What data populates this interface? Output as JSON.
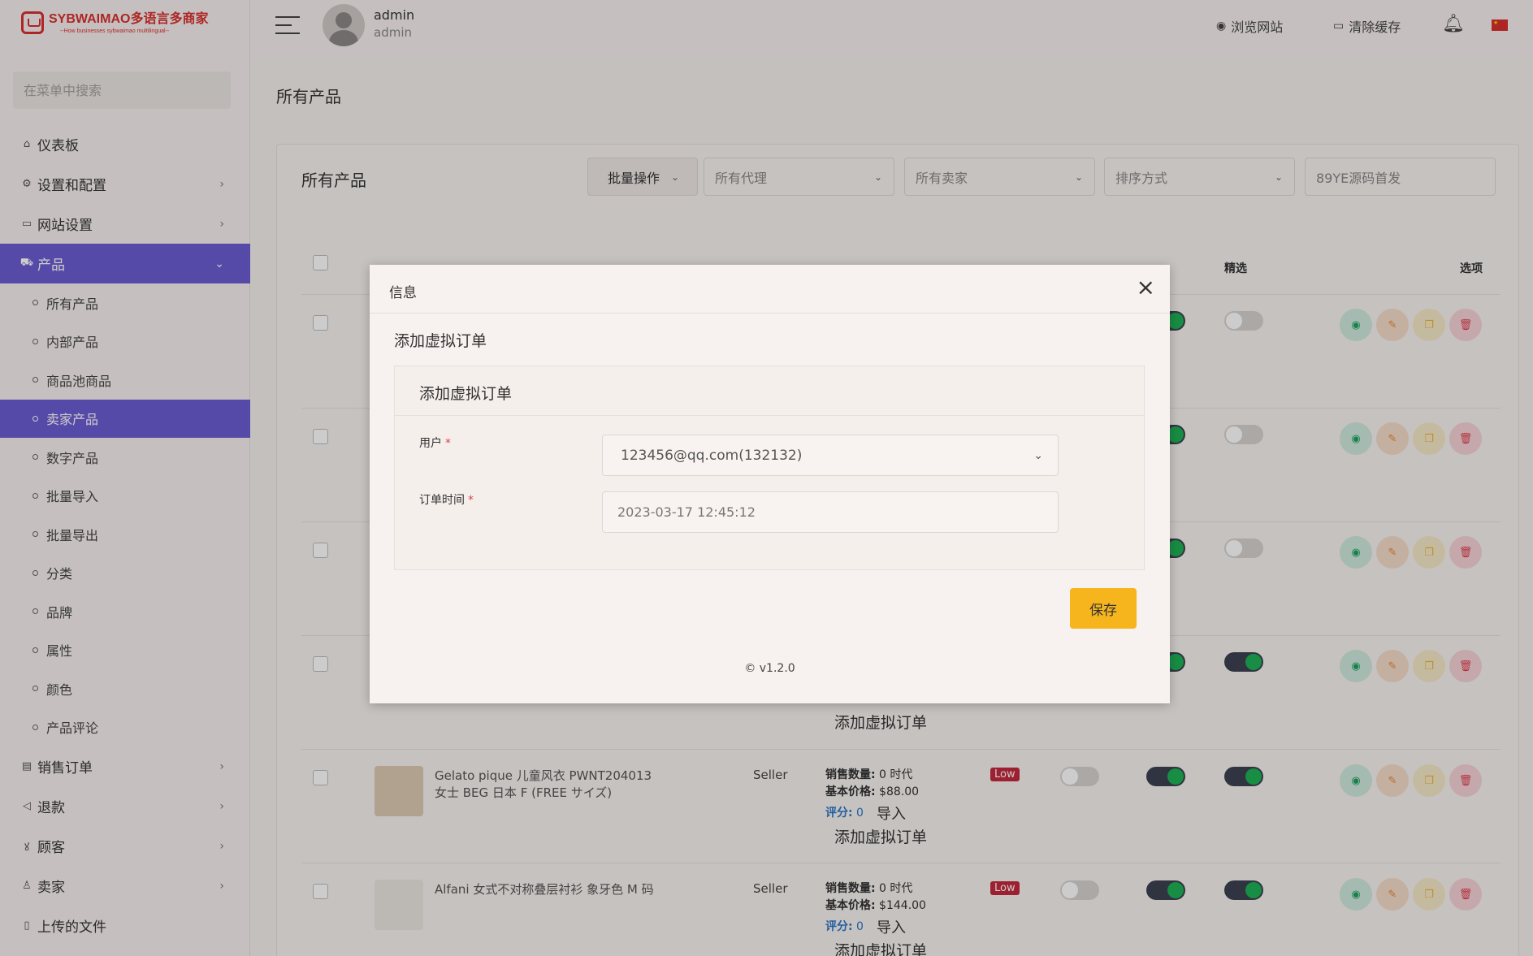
{
  "logo": {
    "title": "SYBWAIMAO多语言多商家",
    "subtitle": "--How businesses sybwaimao multilingual--"
  },
  "sidebar": {
    "search_placeholder": "在菜单中搜索",
    "items": [
      {
        "label": "仪表板",
        "icon": "home-icon"
      },
      {
        "label": "设置和配置",
        "icon": "gear-icon"
      },
      {
        "label": "网站设置",
        "icon": "monitor-icon"
      },
      {
        "label": "产品",
        "icon": "cart-icon"
      },
      {
        "label": "销售订单",
        "icon": "money-icon"
      },
      {
        "label": "退款",
        "icon": "refund-icon"
      },
      {
        "label": "顾客",
        "icon": "users-icon"
      },
      {
        "label": "卖家",
        "icon": "user-icon"
      },
      {
        "label": "上传的文件",
        "icon": "file-icon"
      }
    ],
    "sub_items": [
      "所有产品",
      "内部产品",
      "商品池商品",
      "卖家产品",
      "数字产品",
      "批量导入",
      "批量导出",
      "分类",
      "品牌",
      "属性",
      "颜色",
      "产品评论"
    ]
  },
  "topbar": {
    "user_name": "admin",
    "user_role": "admin",
    "browse_site": "浏览网站",
    "clear_cache": "清除缓存"
  },
  "main": {
    "page_title": "所有产品",
    "card_title": "所有产品",
    "bulk_action": "批量操作",
    "agent_filter": "所有代理",
    "seller_filter": "所有卖家",
    "sort_filter": "排序方式",
    "search_value": "89YE源码首发",
    "col_featured": "精选",
    "col_options": "选项"
  },
  "rows": [
    {
      "name": "Gelato pique 儿童风衣 PWNT204013 女士 BEG 日本 F (FREE サイズ)",
      "seller": "Seller",
      "sales_label": "销售数量:",
      "sales_value": " 0 时代",
      "price_label": "基本价格:",
      "price_value": " $88.00",
      "rating_label": "评分:",
      "rating_value": " 0",
      "import": "导入",
      "add_virtual": "添加虚拟订单",
      "stock": "Low"
    },
    {
      "name": "Alfani 女式不对称叠层衬衫 象牙色 M 码",
      "seller": "Seller",
      "sales_label": "销售数量:",
      "sales_value": " 0 时代",
      "price_label": "基本价格:",
      "price_value": " $144.00",
      "rating_label": "评分:",
      "rating_value": " 0",
      "import": "导入",
      "add_virtual": "添加虚拟订单",
      "stock": "Low"
    }
  ],
  "partial_row": {
    "add_virtual": "添加虚拟订单"
  },
  "modal": {
    "title": "信息",
    "close": "×",
    "subtitle": "添加虚拟订单",
    "panel_title": "添加虚拟订单",
    "user_label": "用户",
    "user_value": "123456@qq.com(132132)",
    "time_label": "订单时间",
    "time_value": "2023-03-17 12:45:12",
    "required_mark": "*",
    "save": "保存",
    "version": "© v1.2.0"
  },
  "colors": {
    "accent": "#6c5dd3",
    "save": "#f6b51d",
    "brand": "#d9302f",
    "toggle_on": "#1fb155",
    "low_badge": "#c5283d"
  }
}
